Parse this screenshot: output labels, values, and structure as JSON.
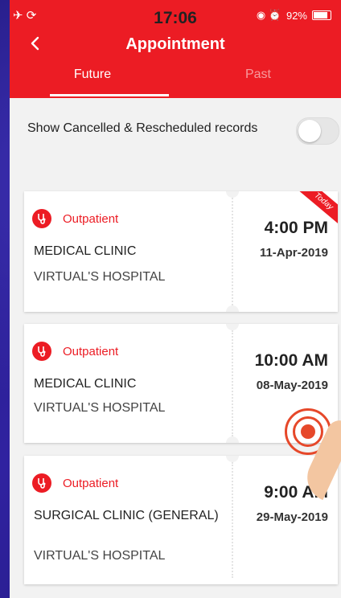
{
  "status_bar": {
    "time": "17:06",
    "battery": "92%",
    "left_icons": "✈ ⟳",
    "right_icons": "◉ ⏰"
  },
  "header": {
    "title": "Appointment",
    "tabs": [
      {
        "label": "Future",
        "active": true
      },
      {
        "label": "Past",
        "active": false
      }
    ]
  },
  "filter": {
    "label": "Show Cancelled & Rescheduled records",
    "enabled": false
  },
  "appointments": [
    {
      "type": "Outpatient",
      "clinic": "MEDICAL CLINIC",
      "hospital": "VIRTUAL'S HOSPITAL",
      "time": "4:00 PM",
      "date": "11-Apr-2019",
      "badge": "Today"
    },
    {
      "type": "Outpatient",
      "clinic": "MEDICAL CLINIC",
      "hospital": "VIRTUAL'S HOSPITAL",
      "time": "10:00 AM",
      "date": "08-May-2019"
    },
    {
      "type": "Outpatient",
      "clinic": "SURGICAL CLINIC (GENERAL)",
      "hospital": "VIRTUAL'S HOSPITAL",
      "time": "9:00 AM",
      "date": "29-May-2019"
    }
  ],
  "colors": {
    "accent": "#ec1c24",
    "background": "#f2f2f2"
  }
}
